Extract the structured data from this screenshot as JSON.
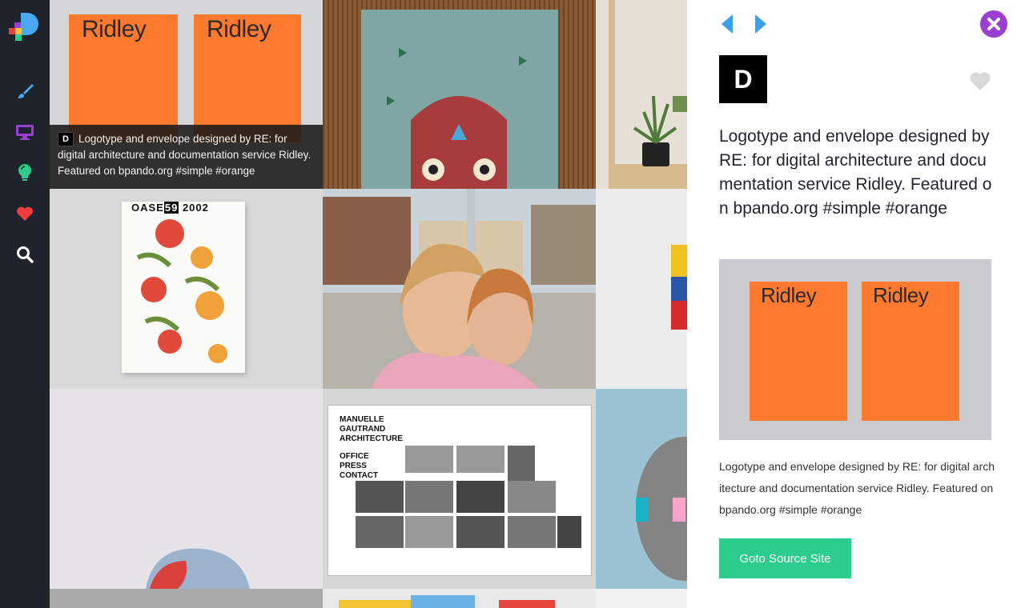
{
  "sidebar": {
    "logo_icon": "brand-logo-icon",
    "items": [
      {
        "name": "brush-icon",
        "color": "#4aa8f0"
      },
      {
        "name": "monitor-icon",
        "color": "#9b3fd4"
      },
      {
        "name": "lightbulb-icon",
        "color": "#2ccc8c"
      },
      {
        "name": "heart-icon",
        "color": "#ef3e3e"
      },
      {
        "name": "search-icon",
        "color": "#ffffff"
      }
    ]
  },
  "grid": {
    "hover_caption": {
      "badge": "D",
      "text": "Logotype and envelope designed by RE: for digital architecture and documentation service Ridley. Featured on bpando.org #simple #orange"
    },
    "tiles": {
      "envelope_word": "Ridley",
      "book_title": "OASE",
      "book_number": "59",
      "book_year": "2002",
      "site_heading": [
        "MANUELLE",
        "GAUTRAND",
        "ARCHITECTURE"
      ],
      "site_nav": [
        "OFFICE",
        "PRESS",
        "CONTACT"
      ]
    }
  },
  "panel": {
    "prev_icon": "arrow-left-icon",
    "next_icon": "arrow-right-icon",
    "close_icon": "close-icon",
    "avatar_letter": "D",
    "favorite_icon": "heart-icon",
    "title": "Logotype and envelope designed by RE: for digital architecture and documentation service Ridley. Featured on bpando.org #simple #orange",
    "description": "Logotype and envelope designed by RE: for digital architecture and documentation service Ridley. Featured on bpando.org #simple #orange",
    "button_label": "Goto Source Site",
    "preview_word": "Ridley"
  },
  "colors": {
    "sidebar_bg": "#1f232b",
    "accent_purple": "#9b3fd4",
    "accent_green": "#2ccc8c",
    "arrow_blue": "#3aa0e8",
    "envelope_orange": "#ff7a2e"
  }
}
